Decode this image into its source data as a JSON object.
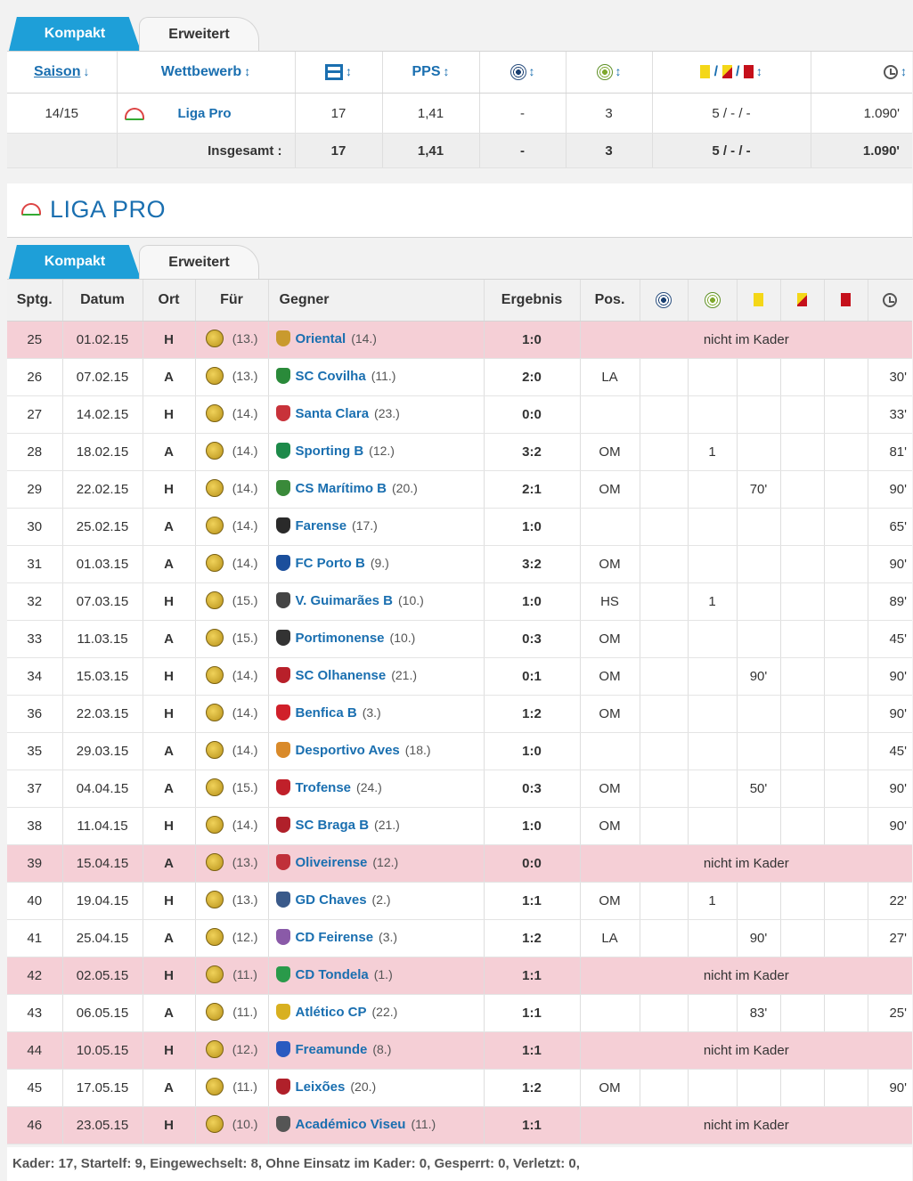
{
  "tabs": {
    "compact": "Kompakt",
    "extended": "Erweitert"
  },
  "season_table": {
    "headers": {
      "saison": "Saison",
      "wettbewerb": "Wettbewerb",
      "pps": "PPS",
      "cards_sep": "/",
      "sort_down": "↓",
      "sort": "↕"
    },
    "row": {
      "season": "14/15",
      "competition": "Liga Pro",
      "games": "17",
      "pps": "1,41",
      "goals": "-",
      "assists": "3",
      "cards": "5 / - / -",
      "minutes": "1.090'"
    },
    "total": {
      "label": "Insgesamt :",
      "games": "17",
      "pps": "1,41",
      "goals": "-",
      "assists": "3",
      "cards": "5 / - / -",
      "minutes": "1.090'"
    }
  },
  "league": {
    "title": "LIGA PRO"
  },
  "match_table": {
    "headers": {
      "sptg": "Sptg.",
      "datum": "Datum",
      "ort": "Ort",
      "fuer": "Für",
      "gegner": "Gegner",
      "ergebnis": "Ergebnis",
      "pos": "Pos."
    },
    "rows": [
      {
        "sptg": "25",
        "date": "01.02.15",
        "venue": "H",
        "own_rank": "(13.)",
        "opponent": "Oriental",
        "opp_rank": "(14.)",
        "result": "1:0",
        "result_type": "win",
        "not_in_squad": "nicht im Kader",
        "crest": "#c99a2e"
      },
      {
        "sptg": "26",
        "date": "07.02.15",
        "venue": "A",
        "own_rank": "(13.)",
        "opponent": "SC Covilha",
        "opp_rank": "(11.)",
        "result": "2:0",
        "result_type": "loss",
        "pos": "LA",
        "goals": "",
        "assists": "",
        "yellow": "",
        "yr": "",
        "red": "",
        "minutes": "30'",
        "crest": "#2a8a3a"
      },
      {
        "sptg": "27",
        "date": "14.02.15",
        "venue": "H",
        "own_rank": "(14.)",
        "opponent": "Santa Clara",
        "opp_rank": "(23.)",
        "result": "0:0",
        "result_type": "draw",
        "pos": "",
        "goals": "",
        "assists": "",
        "yellow": "",
        "yr": "",
        "red": "",
        "minutes": "33'",
        "crest": "#c8323a"
      },
      {
        "sptg": "28",
        "date": "18.02.15",
        "venue": "A",
        "own_rank": "(14.)",
        "opponent": "Sporting B",
        "opp_rank": "(12.)",
        "result": "3:2",
        "result_type": "loss",
        "pos": "OM",
        "goals": "",
        "assists": "1",
        "yellow": "",
        "yr": "",
        "red": "",
        "minutes": "81'",
        "crest": "#1d8a4a"
      },
      {
        "sptg": "29",
        "date": "22.02.15",
        "venue": "H",
        "own_rank": "(14.)",
        "opponent": "CS Marítimo B",
        "opp_rank": "(20.)",
        "result": "2:1",
        "result_type": "win",
        "pos": "OM",
        "goals": "",
        "assists": "",
        "yellow": "70'",
        "yr": "",
        "red": "",
        "minutes": "90'",
        "crest": "#3a8a3a"
      },
      {
        "sptg": "30",
        "date": "25.02.15",
        "venue": "A",
        "own_rank": "(14.)",
        "opponent": "Farense",
        "opp_rank": "(17.)",
        "result": "1:0",
        "result_type": "loss",
        "pos": "",
        "goals": "",
        "assists": "",
        "yellow": "",
        "yr": "",
        "red": "",
        "minutes": "65'",
        "crest": "#2a2a2a"
      },
      {
        "sptg": "31",
        "date": "01.03.15",
        "venue": "A",
        "own_rank": "(14.)",
        "opponent": "FC Porto B",
        "opp_rank": "(9.)",
        "result": "3:2",
        "result_type": "loss",
        "pos": "OM",
        "goals": "",
        "assists": "",
        "yellow": "",
        "yr": "",
        "red": "",
        "minutes": "90'",
        "crest": "#1b4f9c"
      },
      {
        "sptg": "32",
        "date": "07.03.15",
        "venue": "H",
        "own_rank": "(15.)",
        "opponent": "V. Guimarães B",
        "opp_rank": "(10.)",
        "result": "1:0",
        "result_type": "win",
        "pos": "HS",
        "goals": "",
        "assists": "1",
        "yellow": "",
        "yr": "",
        "red": "",
        "minutes": "89'",
        "crest": "#444444"
      },
      {
        "sptg": "33",
        "date": "11.03.15",
        "venue": "A",
        "own_rank": "(15.)",
        "opponent": "Portimonense",
        "opp_rank": "(10.)",
        "result": "0:3",
        "result_type": "win",
        "pos": "OM",
        "goals": "",
        "assists": "",
        "yellow": "",
        "yr": "",
        "red": "",
        "minutes": "45'",
        "crest": "#333333"
      },
      {
        "sptg": "34",
        "date": "15.03.15",
        "venue": "H",
        "own_rank": "(14.)",
        "opponent": "SC Olhanense",
        "opp_rank": "(21.)",
        "result": "0:1",
        "result_type": "loss",
        "pos": "OM",
        "goals": "",
        "assists": "",
        "yellow": "90'",
        "yr": "",
        "red": "",
        "minutes": "90'",
        "crest": "#b8202a"
      },
      {
        "sptg": "36",
        "date": "22.03.15",
        "venue": "H",
        "own_rank": "(14.)",
        "opponent": "Benfica B",
        "opp_rank": "(3.)",
        "result": "1:2",
        "result_type": "loss",
        "pos": "OM",
        "goals": "",
        "assists": "",
        "yellow": "",
        "yr": "",
        "red": "",
        "minutes": "90'",
        "crest": "#d0202a"
      },
      {
        "sptg": "35",
        "date": "29.03.15",
        "venue": "A",
        "own_rank": "(14.)",
        "opponent": "Desportivo Aves",
        "opp_rank": "(18.)",
        "result": "1:0",
        "result_type": "loss",
        "pos": "",
        "goals": "",
        "assists": "",
        "yellow": "",
        "yr": "",
        "red": "",
        "minutes": "45'",
        "crest": "#d98a2a"
      },
      {
        "sptg": "37",
        "date": "04.04.15",
        "venue": "A",
        "own_rank": "(15.)",
        "opponent": "Trofense",
        "opp_rank": "(24.)",
        "result": "0:3",
        "result_type": "win",
        "pos": "OM",
        "goals": "",
        "assists": "",
        "yellow": "50'",
        "yr": "",
        "red": "",
        "minutes": "90'",
        "crest": "#c0202a"
      },
      {
        "sptg": "38",
        "date": "11.04.15",
        "venue": "H",
        "own_rank": "(14.)",
        "opponent": "SC Braga B",
        "opp_rank": "(21.)",
        "result": "1:0",
        "result_type": "win",
        "pos": "OM",
        "goals": "",
        "assists": "",
        "yellow": "",
        "yr": "",
        "red": "",
        "minutes": "90'",
        "crest": "#b0202a"
      },
      {
        "sptg": "39",
        "date": "15.04.15",
        "venue": "A",
        "own_rank": "(13.)",
        "opponent": "Oliveirense",
        "opp_rank": "(12.)",
        "result": "0:0",
        "result_type": "draw",
        "not_in_squad": "nicht im Kader",
        "crest": "#c0303a"
      },
      {
        "sptg": "40",
        "date": "19.04.15",
        "venue": "H",
        "own_rank": "(13.)",
        "opponent": "GD Chaves",
        "opp_rank": "(2.)",
        "result": "1:1",
        "result_type": "draw",
        "pos": "OM",
        "goals": "",
        "assists": "1",
        "yellow": "",
        "yr": "",
        "red": "",
        "minutes": "22'",
        "crest": "#3a5a8a"
      },
      {
        "sptg": "41",
        "date": "25.04.15",
        "venue": "A",
        "own_rank": "(12.)",
        "opponent": "CD Feirense",
        "opp_rank": "(3.)",
        "result": "1:2",
        "result_type": "draw",
        "pos": "LA",
        "goals": "",
        "assists": "",
        "yellow": "90'",
        "yr": "",
        "red": "",
        "minutes": "27'",
        "crest": "#8a5aa8"
      },
      {
        "sptg": "42",
        "date": "02.05.15",
        "venue": "H",
        "own_rank": "(11.)",
        "opponent": "CD Tondela",
        "opp_rank": "(1.)",
        "result": "1:1",
        "result_type": "draw",
        "not_in_squad": "nicht im Kader",
        "crest": "#2a9a4a"
      },
      {
        "sptg": "43",
        "date": "06.05.15",
        "venue": "A",
        "own_rank": "(11.)",
        "opponent": "Atlético CP",
        "opp_rank": "(22.)",
        "result": "1:1",
        "result_type": "draw",
        "pos": "",
        "goals": "",
        "assists": "",
        "yellow": "83'",
        "yr": "",
        "red": "",
        "minutes": "25'",
        "crest": "#d8b020"
      },
      {
        "sptg": "44",
        "date": "10.05.15",
        "venue": "H",
        "own_rank": "(12.)",
        "opponent": "Freamunde",
        "opp_rank": "(8.)",
        "result": "1:1",
        "result_type": "draw",
        "not_in_squad": "nicht im Kader",
        "crest": "#2a5ac0"
      },
      {
        "sptg": "45",
        "date": "17.05.15",
        "venue": "A",
        "own_rank": "(11.)",
        "opponent": "Leixões",
        "opp_rank": "(20.)",
        "result": "1:2",
        "result_type": "draw",
        "pos": "OM",
        "goals": "",
        "assists": "",
        "yellow": "",
        "yr": "",
        "red": "",
        "minutes": "90'",
        "crest": "#b0202a"
      },
      {
        "sptg": "46",
        "date": "23.05.15",
        "venue": "H",
        "own_rank": "(10.)",
        "opponent": "Académico Viseu",
        "opp_rank": "(11.)",
        "result": "1:1",
        "result_type": "draw",
        "not_in_squad": "nicht im Kader",
        "crest": "#555555"
      }
    ]
  },
  "footer": {
    "summary": "Kader: 17, Startelf: 9, Eingewechselt: 8, Ohne Einsatz im Kader: 0, Gesperrt: 0, Verletzt: 0,"
  }
}
